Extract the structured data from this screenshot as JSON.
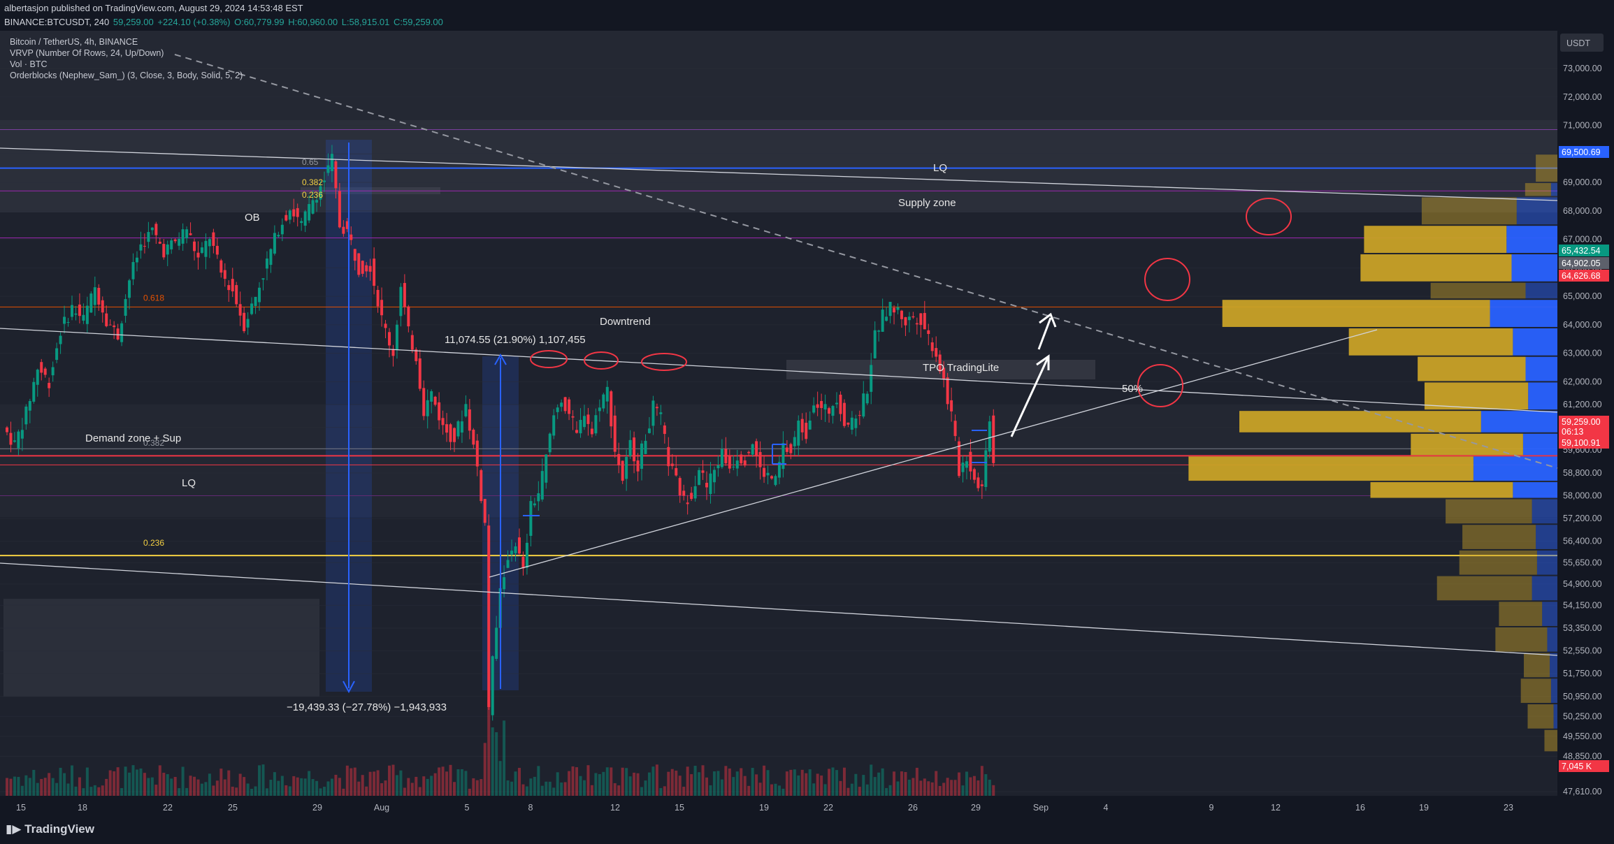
{
  "header": {
    "publisher_line": "albertasjon published on TradingView.com, August 29, 2024 14:53:48 EST",
    "symbol_line": "BINANCE:BTCUSDT, 240",
    "last_price": "59,259.00",
    "change": "+224.10 (+0.38%)",
    "open": "O:60,779.99",
    "high": "H:60,960.00",
    "low": "L:58,915.01",
    "close": "C:59,259.00"
  },
  "legend": {
    "title": "Bitcoin / TetherUS, 4h, BINANCE",
    "ind1": "VRVP (Number Of Rows, 24, Up/Down)",
    "ind2": "Vol · BTC",
    "ind3": "Orderblocks (Nephew_Sam_) (3, Close, 3, Body, Solid, 5, 2)"
  },
  "currency_label": "USDT",
  "footer_logo": "TradingView",
  "chart_data": {
    "type": "candlestick",
    "symbol": "BTCUSDT",
    "timeframe": "4h",
    "ylim": [
      47610,
      73600
    ],
    "y_ticks": [
      "73,000.00",
      "72,000.00",
      "71,000.00",
      "70,000.00",
      "69,000.00",
      "68,000.00",
      "67,000.00",
      "66,000.00",
      "65,000.00",
      "64,000.00",
      "63,000.00",
      "62,000.00",
      "61,200.00",
      "60,400.00",
      "59,600.00",
      "58,800.00",
      "58,000.00",
      "57,200.00",
      "56,400.00",
      "55,650.00",
      "54,900.00",
      "54,150.00",
      "53,350.00",
      "52,550.00",
      "51,750.00",
      "50,950.00",
      "50,250.00",
      "49,550.00",
      "48,850.00",
      "47,610.00"
    ],
    "x_ticks": [
      "15",
      "18",
      "22",
      "25",
      "29",
      "Aug",
      "5",
      "8",
      "12",
      "15",
      "19",
      "22",
      "26",
      "29",
      "Sep",
      "4",
      "9",
      "12",
      "16",
      "19",
      "23"
    ],
    "price_tags": [
      {
        "label": "69,500.69",
        "price": 69500.69,
        "color": "#2962ff"
      },
      {
        "label": "65,432.54",
        "price": 65432.54,
        "color": "#089981"
      },
      {
        "label": "64,902.05",
        "price": 64902.05,
        "color": "#5d606b"
      },
      {
        "label": "64,626.68",
        "price": 64626.68,
        "color": "#f23645"
      },
      {
        "label": "59,259.00",
        "price": 59259.0,
        "color": "#f23645"
      },
      {
        "label": "06:13",
        "price": 58950,
        "color": "#f23645"
      },
      {
        "label": "59,100.91",
        "price": 58650,
        "color": "#f23645"
      },
      {
        "label": "7,045 K",
        "price": 48500,
        "color": "#f23645"
      }
    ],
    "price_path": [
      [
        0,
        60400
      ],
      [
        3,
        59800
      ],
      [
        6,
        60900
      ],
      [
        9,
        62500
      ],
      [
        12,
        62000
      ],
      [
        15,
        63800
      ],
      [
        18,
        64600
      ],
      [
        21,
        64200
      ],
      [
        24,
        65300
      ],
      [
        27,
        64200
      ],
      [
        30,
        63600
      ],
      [
        33,
        65600
      ],
      [
        36,
        66800
      ],
      [
        39,
        67300
      ],
      [
        42,
        66600
      ],
      [
        45,
        66900
      ],
      [
        48,
        67400
      ],
      [
        51,
        66300
      ],
      [
        54,
        67100
      ],
      [
        57,
        65800
      ],
      [
        60,
        65200
      ],
      [
        63,
        64000
      ],
      [
        66,
        65000
      ],
      [
        69,
        66200
      ],
      [
        72,
        67400
      ],
      [
        75,
        68100
      ],
      [
        78,
        67500
      ],
      [
        81,
        68400
      ],
      [
        84,
        69100
      ],
      [
        86,
        69800
      ],
      [
        88,
        67500
      ],
      [
        90,
        67300
      ],
      [
        93,
        66000
      ],
      [
        96,
        66100
      ],
      [
        99,
        64200
      ],
      [
        102,
        63000
      ],
      [
        104,
        65300
      ],
      [
        106,
        63700
      ],
      [
        108,
        62900
      ],
      [
        110,
        61000
      ],
      [
        112,
        61600
      ],
      [
        115,
        60400
      ],
      [
        118,
        60000
      ],
      [
        121,
        61200
      ],
      [
        124,
        59000
      ],
      [
        126,
        57000
      ],
      [
        127,
        50500
      ],
      [
        128,
        52200
      ],
      [
        130,
        54600
      ],
      [
        132,
        55900
      ],
      [
        134,
        56400
      ],
      [
        136,
        55300
      ],
      [
        138,
        57600
      ],
      [
        140,
        58100
      ],
      [
        142,
        59300
      ],
      [
        144,
        60800
      ],
      [
        146,
        61400
      ],
      [
        148,
        60900
      ],
      [
        150,
        60100
      ],
      [
        152,
        61000
      ],
      [
        154,
        60200
      ],
      [
        156,
        61300
      ],
      [
        158,
        61700
      ],
      [
        160,
        59600
      ],
      [
        162,
        58600
      ],
      [
        164,
        59800
      ],
      [
        166,
        59100
      ],
      [
        168,
        60100
      ],
      [
        170,
        61100
      ],
      [
        172,
        60700
      ],
      [
        174,
        59200
      ],
      [
        176,
        58500
      ],
      [
        178,
        57800
      ],
      [
        180,
        58100
      ],
      [
        182,
        59000
      ],
      [
        184,
        58300
      ],
      [
        186,
        58900
      ],
      [
        188,
        59500
      ],
      [
        190,
        59000
      ],
      [
        192,
        59400
      ],
      [
        194,
        59300
      ],
      [
        196,
        59900
      ],
      [
        198,
        58900
      ],
      [
        200,
        58700
      ],
      [
        202,
        58500
      ],
      [
        204,
        59700
      ],
      [
        206,
        59500
      ],
      [
        208,
        60500
      ],
      [
        210,
        60200
      ],
      [
        212,
        61400
      ],
      [
        214,
        61000
      ],
      [
        216,
        61000
      ],
      [
        218,
        61500
      ],
      [
        220,
        60600
      ],
      [
        222,
        60500
      ],
      [
        224,
        61000
      ],
      [
        226,
        61800
      ],
      [
        228,
        63600
      ],
      [
        230,
        64300
      ],
      [
        232,
        64600
      ],
      [
        234,
        64500
      ],
      [
        236,
        64100
      ],
      [
        238,
        64300
      ],
      [
        240,
        64200
      ],
      [
        242,
        63600
      ],
      [
        244,
        63000
      ],
      [
        246,
        62000
      ],
      [
        248,
        60800
      ],
      [
        250,
        58900
      ],
      [
        252,
        59400
      ],
      [
        254,
        58600
      ],
      [
        256,
        58300
      ],
      [
        258,
        60800
      ],
      [
        259,
        59259
      ]
    ],
    "volume_profile": [
      {
        "price_low": 69000,
        "price_high": 70000,
        "up": 0.05,
        "down": 0.0
      },
      {
        "price_low": 68500,
        "price_high": 69000,
        "up": 0.06,
        "down": 0.05
      },
      {
        "price_low": 67500,
        "price_high": 68500,
        "up": 0.22,
        "down": 0.32
      },
      {
        "price_low": 66500,
        "price_high": 67500,
        "up": 0.33,
        "down": 0.4
      },
      {
        "price_low": 65500,
        "price_high": 66500,
        "up": 0.35,
        "down": 0.36
      },
      {
        "price_low": 64900,
        "price_high": 65500,
        "up": 0.22,
        "down": 0.25
      },
      {
        "price_low": 63900,
        "price_high": 64900,
        "up": 0.62,
        "down": 0.53
      },
      {
        "price_low": 62900,
        "price_high": 63900,
        "up": 0.38,
        "down": 0.35
      },
      {
        "price_low": 62000,
        "price_high": 62900,
        "up": 0.25,
        "down": 0.25
      },
      {
        "price_low": 61000,
        "price_high": 62000,
        "up": 0.24,
        "down": 0.23
      },
      {
        "price_low": 60200,
        "price_high": 61000,
        "up": 0.56,
        "down": 0.6
      },
      {
        "price_low": 59400,
        "price_high": 60200,
        "up": 0.26,
        "down": 0.27
      },
      {
        "price_low": 58500,
        "price_high": 59400,
        "up": 0.66,
        "down": 0.66
      },
      {
        "price_low": 57900,
        "price_high": 58500,
        "up": 0.33,
        "down": 0.35
      },
      {
        "price_low": 57000,
        "price_high": 57900,
        "up": 0.2,
        "down": 0.2
      },
      {
        "price_low": 56100,
        "price_high": 57000,
        "up": 0.17,
        "down": 0.17
      },
      {
        "price_low": 55200,
        "price_high": 56100,
        "up": 0.18,
        "down": 0.16
      },
      {
        "price_low": 54300,
        "price_high": 55200,
        "up": 0.22,
        "down": 0.2
      },
      {
        "price_low": 53400,
        "price_high": 54300,
        "up": 0.1,
        "down": 0.12
      },
      {
        "price_low": 52500,
        "price_high": 53400,
        "up": 0.12,
        "down": 0.08
      },
      {
        "price_low": 51600,
        "price_high": 52500,
        "up": 0.06,
        "down": 0.06
      },
      {
        "price_low": 50700,
        "price_high": 51600,
        "up": 0.07,
        "down": 0.05
      },
      {
        "price_low": 49800,
        "price_high": 50700,
        "up": 0.06,
        "down": 0.03
      },
      {
        "price_low": 49000,
        "price_high": 49800,
        "up": 0.03,
        "down": 0.0
      }
    ],
    "fib_levels": [
      {
        "label": "0.618",
        "price": 64800
      },
      {
        "label": "0.382",
        "price": 59700
      },
      {
        "label": "0.236",
        "price": 56200
      }
    ],
    "annotations": {
      "lq_top": "LQ",
      "supply_zone": "Supply zone",
      "ob": "OB",
      "downtrend": "Downtrend",
      "measure_up": "11,074.55 (21.90%) 1,107,455",
      "measure_down": "−19,439.33 (−27.78%) −1,943,933",
      "tpo": "TPO TradingLite",
      "fifty": "50%",
      "demand_zone": "Demand zone + Sup",
      "lq_bottom": "LQ",
      "fib_small_1": "0.65",
      "fib_small_2": "0.382",
      "fib_small_3": "0.236"
    }
  }
}
